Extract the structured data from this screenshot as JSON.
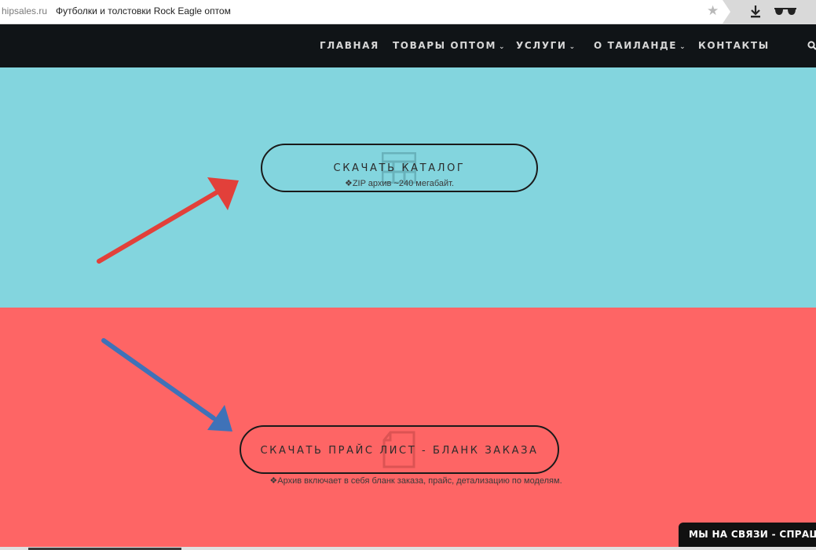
{
  "browser": {
    "domain": "hipsales.ru",
    "tab_title": "Футболки и толстовки Rock Eagle оптом",
    "icons": [
      "star-icon",
      "download-icon",
      "glasses-icon"
    ]
  },
  "nav": {
    "items": [
      {
        "label": "ГЛАВНАЯ",
        "has_dropdown": false
      },
      {
        "label": "ТОВАРЫ ОПТОМ",
        "has_dropdown": true
      },
      {
        "label": "УСЛУГИ",
        "has_dropdown": true
      },
      {
        "label": "О ТАИЛАНДЕ",
        "has_dropdown": true
      },
      {
        "label": "КОНТАКТЫ",
        "has_dropdown": false
      }
    ],
    "chevron": "⌄"
  },
  "catalog": {
    "button_label": "СКАЧАТЬ КАТАЛОГ",
    "subtext": "ZIP архив ~240 мегабайт.",
    "bg_color": "#83d5de"
  },
  "price": {
    "button_label": "СКАЧАТЬ ПРАЙС ЛИСТ - БЛАНК ЗАКАЗА",
    "subtext": "Архив включает в себя бланк заказа, прайс, детализацию по моделям.",
    "bg_color": "#fe6565"
  },
  "annotations": {
    "red_arrow_color": "#e2403a",
    "blue_arrow_color": "#3f72b8"
  },
  "chat": {
    "label": "МЫ НА СВЯЗИ - СПРАШИВАЙТЕ"
  },
  "colors": {
    "nav_bg": "#101417",
    "nav_text": "#d6d6d6"
  }
}
